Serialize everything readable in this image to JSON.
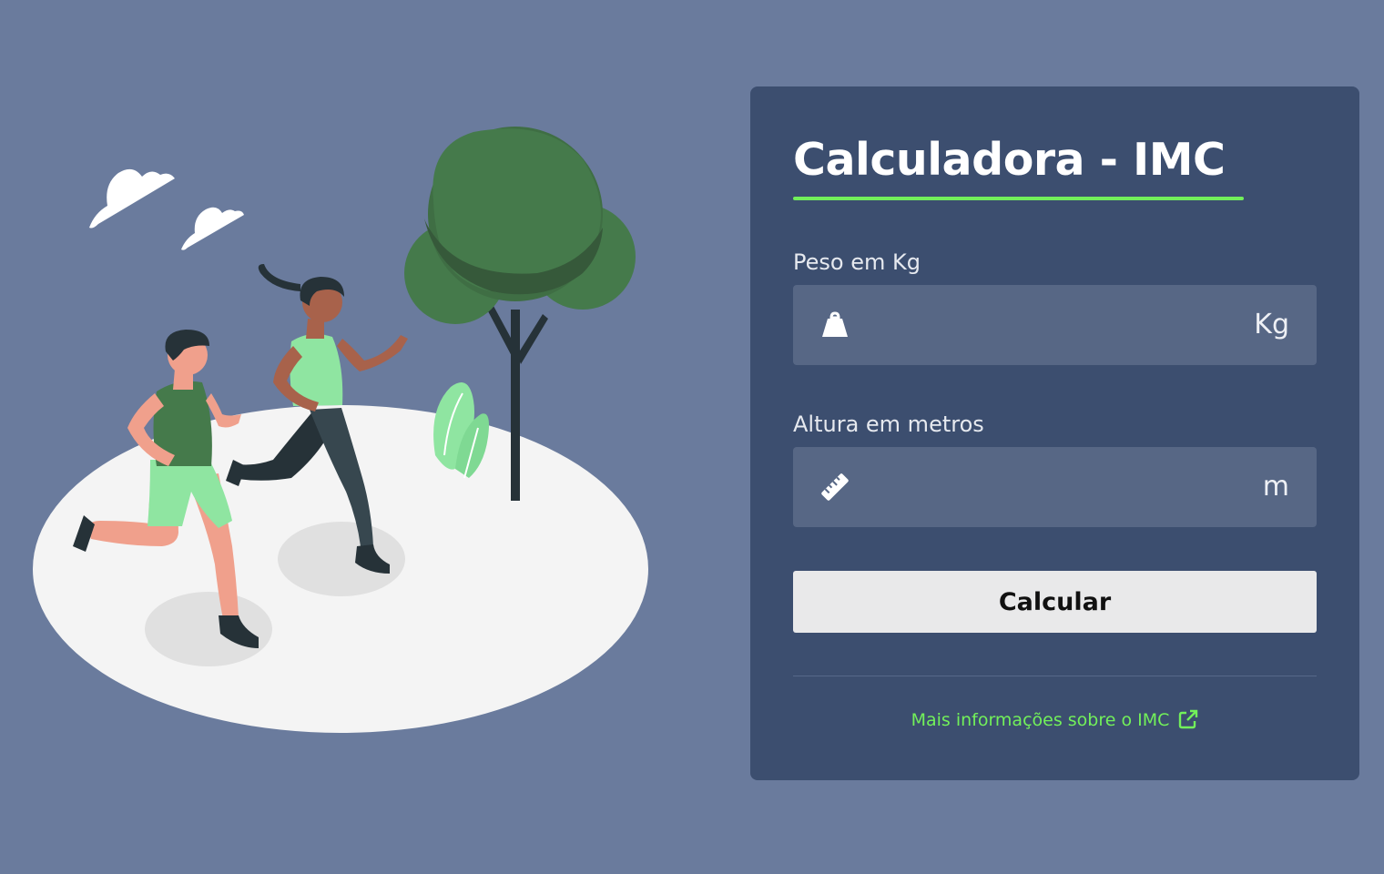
{
  "theme": {
    "background": "#6a7b9d",
    "card": "#3c4e6f",
    "accent": "#72f05a",
    "input_background": "#576785",
    "button_background": "#e9e9ea"
  },
  "illustration": {
    "subject": "two people jogging in a park",
    "icons": [
      "cloud-icon",
      "tree-icon",
      "plant-icon"
    ]
  },
  "calculator": {
    "title": "Calculadora - IMC",
    "weight": {
      "label": "Peso em Kg",
      "icon": "weight-icon",
      "value": "",
      "unit": "Kg"
    },
    "height": {
      "label": "Altura em metros",
      "icon": "ruler-icon",
      "value": "",
      "unit": "m"
    },
    "button_label": "Calcular",
    "info_link": {
      "text": "Mais informações sobre o IMC",
      "icon": "external-link-icon"
    }
  }
}
